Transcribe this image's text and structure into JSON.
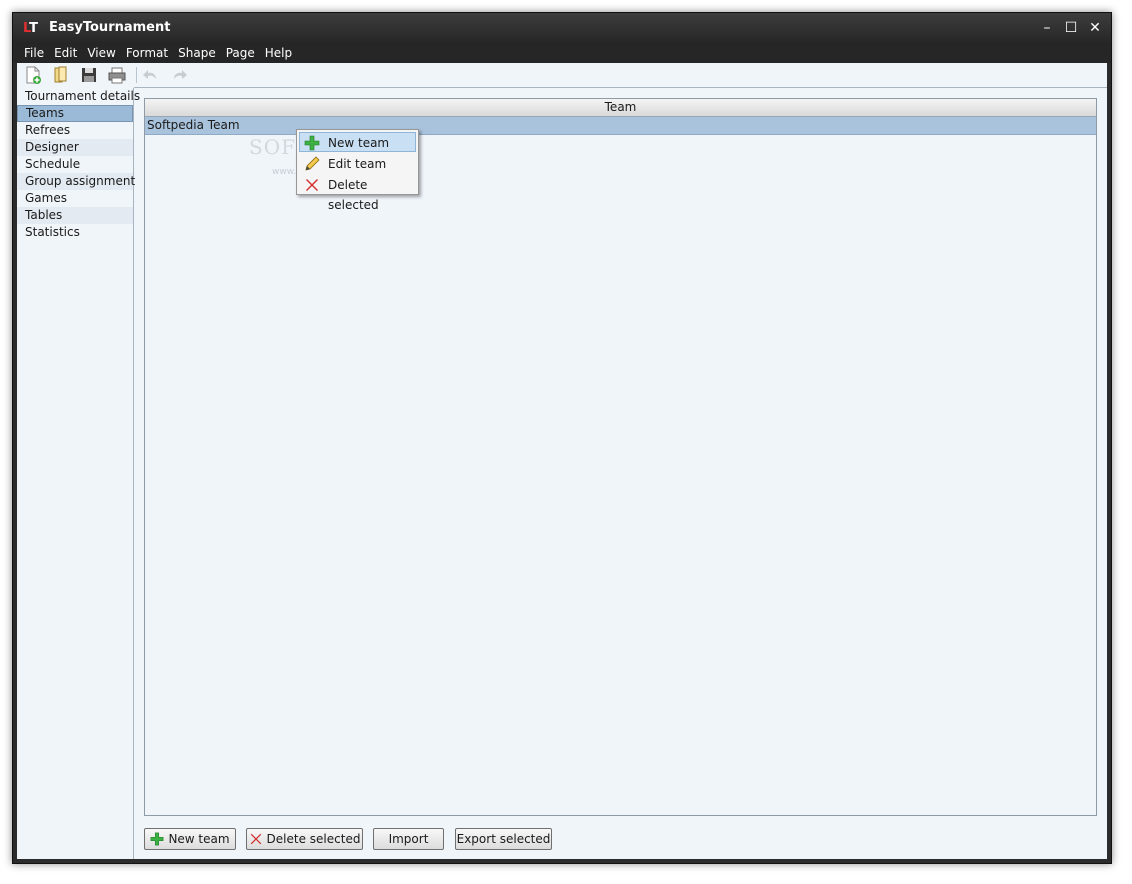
{
  "window": {
    "logo": {
      "l": "L",
      "t": "T"
    },
    "title": "EasyTournament",
    "controls": {
      "minimize": "–",
      "maximize": "☐",
      "close": "✕"
    }
  },
  "menubar": {
    "items": [
      "File",
      "Edit",
      "View",
      "Format",
      "Shape",
      "Page",
      "Help"
    ]
  },
  "toolbar": {
    "icons": [
      "new-document-icon",
      "open-icon",
      "save-icon",
      "print-icon",
      "undo-icon",
      "redo-icon"
    ]
  },
  "sidebar": {
    "items": [
      {
        "label": "Tournament details"
      },
      {
        "label": "Teams",
        "selected": true
      },
      {
        "label": "Refrees"
      },
      {
        "label": "Designer"
      },
      {
        "label": "Schedule"
      },
      {
        "label": "Group assignment"
      },
      {
        "label": "Games"
      },
      {
        "label": "Tables"
      },
      {
        "label": "Statistics"
      }
    ]
  },
  "grid": {
    "column_header": "Team",
    "rows": [
      "Softpedia Team"
    ]
  },
  "watermark": {
    "text": "SOFTPEDIA",
    "url": "www.softpedia.com"
  },
  "context_menu": {
    "items": [
      {
        "label": "New team",
        "icon": "green-plus-icon"
      },
      {
        "label": "Edit team",
        "icon": "pencil-icon"
      },
      {
        "label": "Delete selected",
        "icon": "red-x-icon"
      }
    ]
  },
  "buttons": {
    "new_team": "New team",
    "delete_selected": "Delete selected",
    "import": "Import",
    "export_selected": "Export selected"
  },
  "colors": {
    "selection": "#9bbad7",
    "row_highlight": "#a9c3dc",
    "window_frame": "#2b2b2b",
    "background": "#f0f5fa"
  }
}
